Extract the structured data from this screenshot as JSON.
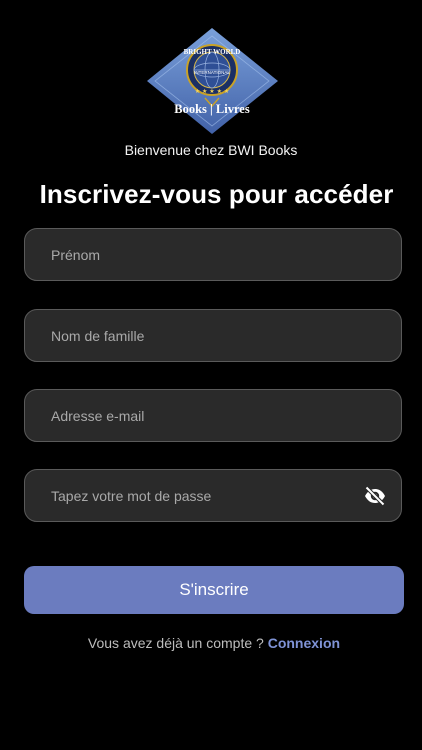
{
  "brand": {
    "logo_top_text": "BRIGHT WORLD",
    "logo_middle_text": "INTERNATIONAL",
    "logo_bottom_text": "Books | Livres",
    "colors": {
      "diamond_top": "#6f93ce",
      "diamond_bottom": "#4b6fb5",
      "gold": "#c9a227"
    }
  },
  "header": {
    "welcome": "Bienvenue chez BWI Books",
    "title": "Inscrivez-vous pour accéder"
  },
  "form": {
    "first_name": {
      "placeholder": "Prénom",
      "value": ""
    },
    "last_name": {
      "placeholder": "Nom de famille",
      "value": ""
    },
    "email": {
      "placeholder": "Adresse e-mail",
      "value": ""
    },
    "password": {
      "placeholder": "Tapez votre mot de passe",
      "value": "",
      "toggle_icon": "eye-off-icon"
    },
    "submit_label": "S'inscrire"
  },
  "footer": {
    "prompt": "Vous avez déjà un compte ? ",
    "login_link": "Connexion"
  },
  "colors": {
    "background": "#000000",
    "field_bg": "#2a2a2a",
    "field_border": "#5a5a5a",
    "accent": "#6b7cbf",
    "link": "#7f93d6"
  }
}
